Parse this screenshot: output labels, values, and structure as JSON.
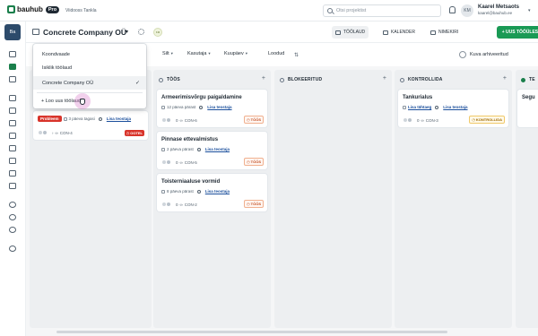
{
  "topbar": {
    "logo_text": "bauhub",
    "plan_badge": "Pro",
    "company": "Viidooss Tankla",
    "search_placeholder": "Otsi projektist",
    "user_initials": "KM",
    "user_name": "Kaarel Metsaots",
    "user_email": "kaarel@bauhub.ee"
  },
  "sidebar": {
    "workspace_badge": "Ba",
    "icons": [
      "home-icon",
      "board-icon",
      "list-icon",
      "tools-icon",
      "documents-icon",
      "checklist-icon",
      "box-icon",
      "stack-icon",
      "chart-icon",
      "tasks-icon",
      "check-icon",
      "settings-icon",
      "history-icon",
      "refresh-icon",
      "help-icon"
    ]
  },
  "header": {
    "board_title": "Concrete Company OÜ",
    "views": [
      {
        "label": "TÖÖLAUD",
        "active": true
      },
      {
        "label": "KALENDER",
        "active": false
      },
      {
        "label": "NIMEKIRI",
        "active": false
      }
    ],
    "new_task_label": "+ UUS TÖÖÜLESANNE"
  },
  "filters": {
    "items": [
      "Silt",
      "Kasutaja",
      "Kuupäev",
      "Loodud"
    ],
    "archived_label": "Kuva arhiveeritud"
  },
  "dropdown": {
    "items": [
      {
        "label": "Koondvaade",
        "selected": false
      },
      {
        "label": "Isiklik töölaud",
        "selected": false
      },
      {
        "label": "Concrete Company OÜ",
        "selected": true
      }
    ],
    "new_board_label": "+ Loo uus töölaud"
  },
  "columns": [
    {
      "title": "TÖÖS"
    },
    {
      "title": "BLOKEERITUD"
    },
    {
      "title": "KONTROLLIDA"
    },
    {
      "title": "TE"
    }
  ],
  "behind_card": {
    "tag": "Probleem",
    "meta": "3 päeva tagasi",
    "assignee_link": "Lisa teostaja",
    "code": "CON-4",
    "status": "OOTEL"
  },
  "cards_todo": [
    {
      "title": "Armeerimisvõrgu paigaldamine",
      "meta": "12 päeva pärast",
      "assignee_link": "Lisa teostaja",
      "count": "0",
      "code": "CON-6",
      "status": "TÖÖS"
    },
    {
      "title": "Pinnase ettevalmistus",
      "meta": "2 päeva pärast",
      "assignee_link": "Lisa teostaja",
      "count": "0",
      "code": "CON-5",
      "status": "TÖÖS"
    },
    {
      "title": "Toisterniaaluse vormid",
      "meta": "8 päeva pärast",
      "assignee_link": "Lisa teostaja",
      "count": "0",
      "code": "CON-2",
      "status": "TÖÖS"
    }
  ],
  "card_review": {
    "title": "Tankurialus",
    "due_link": "Lisa tähtaeg",
    "assignee_link": "Lisa teostaja",
    "count": "0",
    "code": "CON-3",
    "status": "KONTROLLIDA"
  },
  "card_partial": {
    "title": "Segu"
  },
  "colors": {
    "accent": "#1a9a55",
    "danger": "#d8342b",
    "link": "#1b4f9c"
  }
}
